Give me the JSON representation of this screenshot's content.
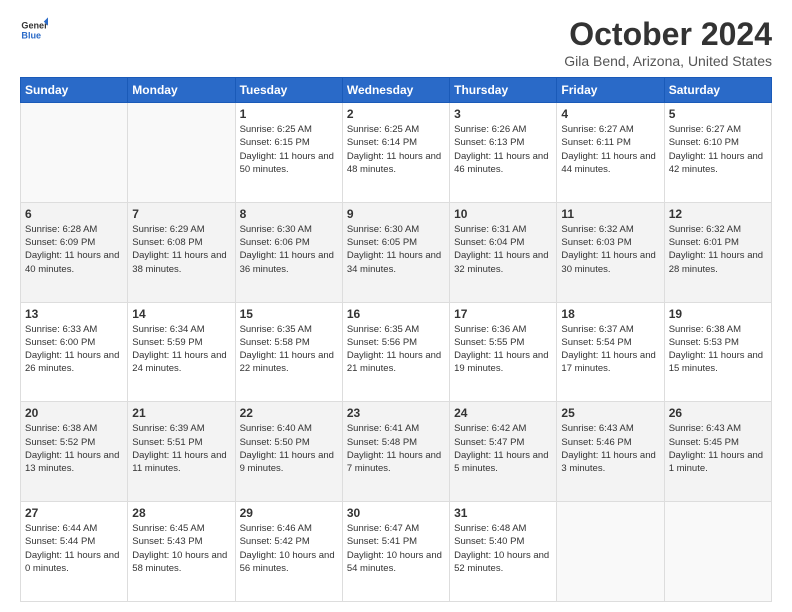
{
  "header": {
    "logo_line1": "General",
    "logo_line2": "Blue",
    "title": "October 2024",
    "subtitle": "Gila Bend, Arizona, United States"
  },
  "days_of_week": [
    "Sunday",
    "Monday",
    "Tuesday",
    "Wednesday",
    "Thursday",
    "Friday",
    "Saturday"
  ],
  "weeks": [
    [
      {
        "day": "",
        "detail": ""
      },
      {
        "day": "",
        "detail": ""
      },
      {
        "day": "1",
        "detail": "Sunrise: 6:25 AM\nSunset: 6:15 PM\nDaylight: 11 hours and 50 minutes."
      },
      {
        "day": "2",
        "detail": "Sunrise: 6:25 AM\nSunset: 6:14 PM\nDaylight: 11 hours and 48 minutes."
      },
      {
        "day": "3",
        "detail": "Sunrise: 6:26 AM\nSunset: 6:13 PM\nDaylight: 11 hours and 46 minutes."
      },
      {
        "day": "4",
        "detail": "Sunrise: 6:27 AM\nSunset: 6:11 PM\nDaylight: 11 hours and 44 minutes."
      },
      {
        "day": "5",
        "detail": "Sunrise: 6:27 AM\nSunset: 6:10 PM\nDaylight: 11 hours and 42 minutes."
      }
    ],
    [
      {
        "day": "6",
        "detail": "Sunrise: 6:28 AM\nSunset: 6:09 PM\nDaylight: 11 hours and 40 minutes."
      },
      {
        "day": "7",
        "detail": "Sunrise: 6:29 AM\nSunset: 6:08 PM\nDaylight: 11 hours and 38 minutes."
      },
      {
        "day": "8",
        "detail": "Sunrise: 6:30 AM\nSunset: 6:06 PM\nDaylight: 11 hours and 36 minutes."
      },
      {
        "day": "9",
        "detail": "Sunrise: 6:30 AM\nSunset: 6:05 PM\nDaylight: 11 hours and 34 minutes."
      },
      {
        "day": "10",
        "detail": "Sunrise: 6:31 AM\nSunset: 6:04 PM\nDaylight: 11 hours and 32 minutes."
      },
      {
        "day": "11",
        "detail": "Sunrise: 6:32 AM\nSunset: 6:03 PM\nDaylight: 11 hours and 30 minutes."
      },
      {
        "day": "12",
        "detail": "Sunrise: 6:32 AM\nSunset: 6:01 PM\nDaylight: 11 hours and 28 minutes."
      }
    ],
    [
      {
        "day": "13",
        "detail": "Sunrise: 6:33 AM\nSunset: 6:00 PM\nDaylight: 11 hours and 26 minutes."
      },
      {
        "day": "14",
        "detail": "Sunrise: 6:34 AM\nSunset: 5:59 PM\nDaylight: 11 hours and 24 minutes."
      },
      {
        "day": "15",
        "detail": "Sunrise: 6:35 AM\nSunset: 5:58 PM\nDaylight: 11 hours and 22 minutes."
      },
      {
        "day": "16",
        "detail": "Sunrise: 6:35 AM\nSunset: 5:56 PM\nDaylight: 11 hours and 21 minutes."
      },
      {
        "day": "17",
        "detail": "Sunrise: 6:36 AM\nSunset: 5:55 PM\nDaylight: 11 hours and 19 minutes."
      },
      {
        "day": "18",
        "detail": "Sunrise: 6:37 AM\nSunset: 5:54 PM\nDaylight: 11 hours and 17 minutes."
      },
      {
        "day": "19",
        "detail": "Sunrise: 6:38 AM\nSunset: 5:53 PM\nDaylight: 11 hours and 15 minutes."
      }
    ],
    [
      {
        "day": "20",
        "detail": "Sunrise: 6:38 AM\nSunset: 5:52 PM\nDaylight: 11 hours and 13 minutes."
      },
      {
        "day": "21",
        "detail": "Sunrise: 6:39 AM\nSunset: 5:51 PM\nDaylight: 11 hours and 11 minutes."
      },
      {
        "day": "22",
        "detail": "Sunrise: 6:40 AM\nSunset: 5:50 PM\nDaylight: 11 hours and 9 minutes."
      },
      {
        "day": "23",
        "detail": "Sunrise: 6:41 AM\nSunset: 5:48 PM\nDaylight: 11 hours and 7 minutes."
      },
      {
        "day": "24",
        "detail": "Sunrise: 6:42 AM\nSunset: 5:47 PM\nDaylight: 11 hours and 5 minutes."
      },
      {
        "day": "25",
        "detail": "Sunrise: 6:43 AM\nSunset: 5:46 PM\nDaylight: 11 hours and 3 minutes."
      },
      {
        "day": "26",
        "detail": "Sunrise: 6:43 AM\nSunset: 5:45 PM\nDaylight: 11 hours and 1 minute."
      }
    ],
    [
      {
        "day": "27",
        "detail": "Sunrise: 6:44 AM\nSunset: 5:44 PM\nDaylight: 11 hours and 0 minutes."
      },
      {
        "day": "28",
        "detail": "Sunrise: 6:45 AM\nSunset: 5:43 PM\nDaylight: 10 hours and 58 minutes."
      },
      {
        "day": "29",
        "detail": "Sunrise: 6:46 AM\nSunset: 5:42 PM\nDaylight: 10 hours and 56 minutes."
      },
      {
        "day": "30",
        "detail": "Sunrise: 6:47 AM\nSunset: 5:41 PM\nDaylight: 10 hours and 54 minutes."
      },
      {
        "day": "31",
        "detail": "Sunrise: 6:48 AM\nSunset: 5:40 PM\nDaylight: 10 hours and 52 minutes."
      },
      {
        "day": "",
        "detail": ""
      },
      {
        "day": "",
        "detail": ""
      }
    ]
  ]
}
